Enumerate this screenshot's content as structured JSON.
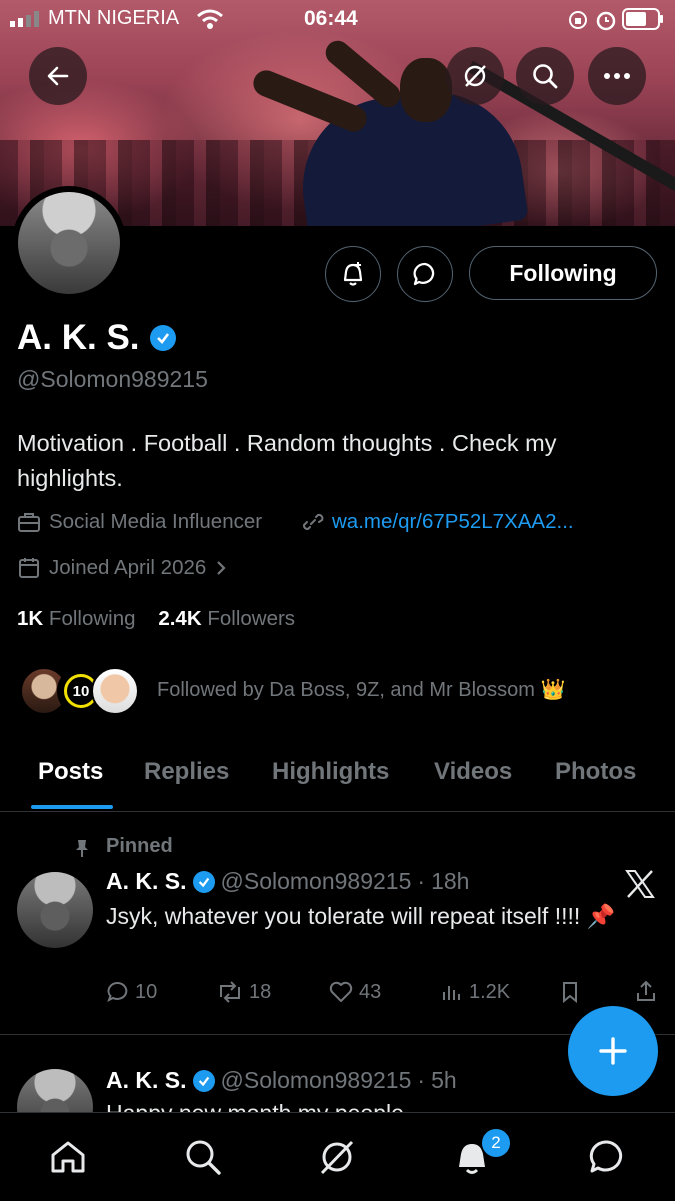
{
  "status_bar": {
    "carrier": "MTN NIGERIA",
    "time": "06:44"
  },
  "profile": {
    "display_name": "A. K. S.",
    "handle": "@Solomon989215",
    "bio": "Motivation . Football . Random thoughts . Check my highlights.",
    "category": "Social Media Influencer",
    "link": "wa.me/qr/67P52L7XAA2...",
    "joined": "Joined April 2026",
    "following_count": "1K",
    "following_label": "Following",
    "followers_count": "2.4K",
    "followers_label": "Followers",
    "followed_by": "Followed by Da Boss, 9Z, and Mr Blossom 👑",
    "follow_button": "Following",
    "mini_badge": "10"
  },
  "tabs": [
    {
      "label": "Posts"
    },
    {
      "label": "Replies"
    },
    {
      "label": "Highlights"
    },
    {
      "label": "Videos"
    },
    {
      "label": "Photos"
    }
  ],
  "posts": [
    {
      "pinned_label": "Pinned",
      "name": "A. K. S.",
      "handle": "@Solomon989215",
      "time": "18h",
      "text": "Jsyk, whatever you tolerate will repeat itself !!!! 📌",
      "replies": "10",
      "reposts": "18",
      "likes": "43",
      "views": "1.2K"
    },
    {
      "name": "A. K. S.",
      "handle": "@Solomon989215",
      "time": "5h",
      "text": "Happy new month my people"
    }
  ],
  "nav": {
    "notification_count": "2"
  },
  "colors": {
    "accent": "#1d9bf0",
    "background": "#000000",
    "muted": "#71767b"
  }
}
